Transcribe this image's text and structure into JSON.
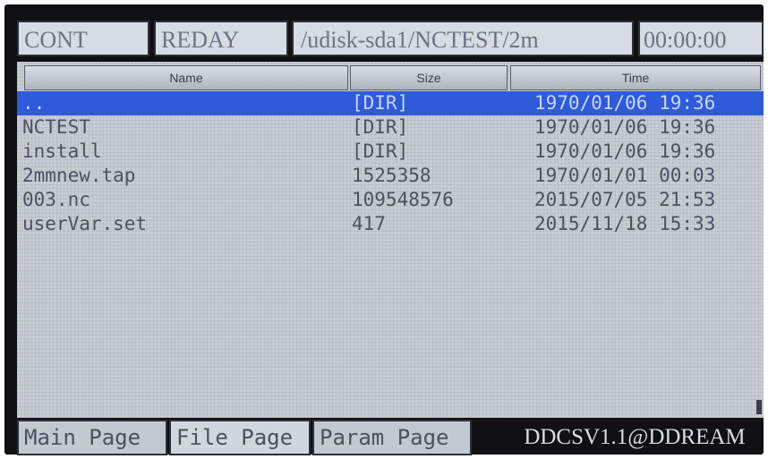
{
  "status_bar": {
    "mode": "CONT",
    "state": "REDAY",
    "path": "/udisk-sda1/NCTEST/2m",
    "clock": "00:00:00"
  },
  "file_list": {
    "columns": [
      "Name",
      "Size",
      "Time"
    ],
    "selected_index": 0,
    "rows": [
      {
        "name": "..",
        "size": "[DIR]",
        "time": "1970/01/06 19:36"
      },
      {
        "name": "NCTEST",
        "size": "[DIR]",
        "time": "1970/01/06 19:36"
      },
      {
        "name": "install",
        "size": "[DIR]",
        "time": "1970/01/06 19:36"
      },
      {
        "name": "2mmnew.tap",
        "size": "1525358",
        "time": "1970/01/01 00:03"
      },
      {
        "name": "003.nc",
        "size": "109548576",
        "time": "2015/07/05 21:53"
      },
      {
        "name": "userVar.set",
        "size": "417",
        "time": "2015/11/18 15:33"
      }
    ]
  },
  "tabs": [
    {
      "label": "Main Page"
    },
    {
      "label": "File Page"
    },
    {
      "label": "Param Page"
    }
  ],
  "active_tab": "File Page",
  "version_text": "DDCSV1.1@DDREAM",
  "colors": {
    "selection": "#2f5bd8",
    "panel_bg": "#c8ccd3",
    "screen_bg": "#101012"
  }
}
